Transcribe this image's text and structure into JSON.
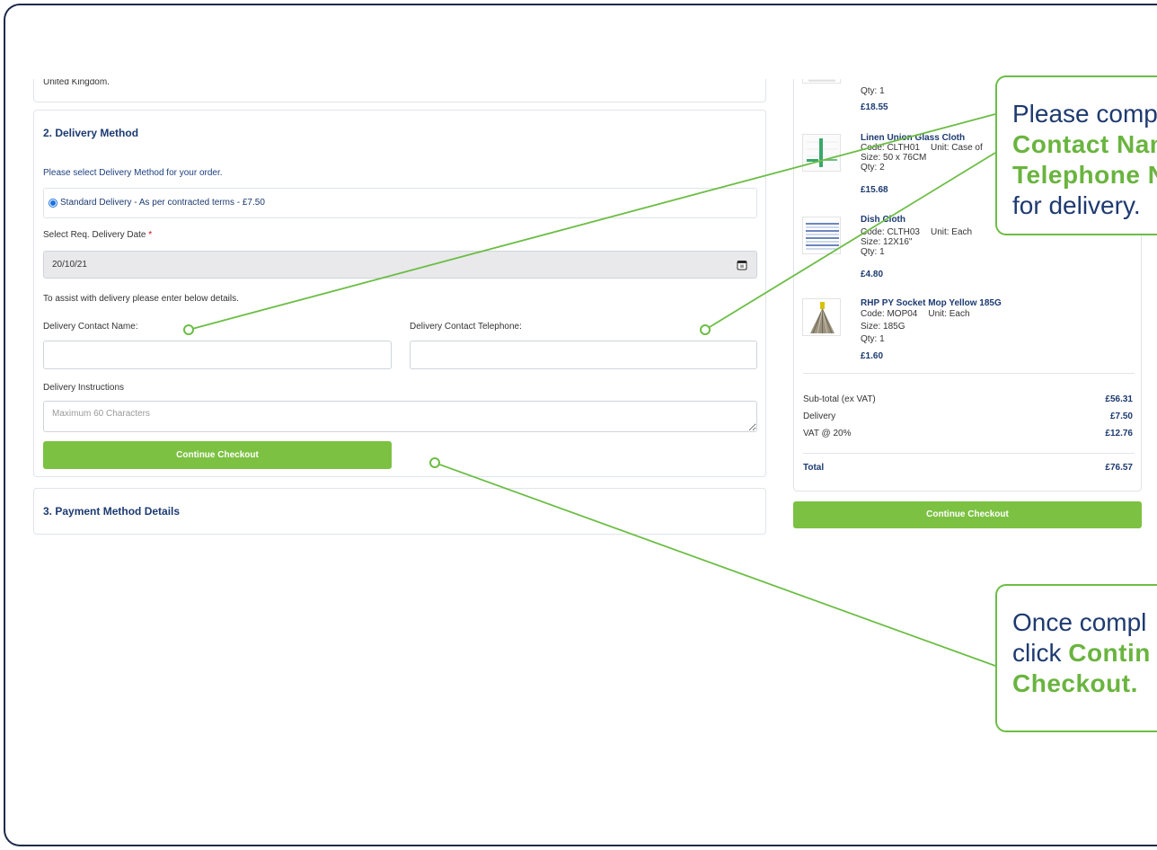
{
  "colors": {
    "frame": "#1c2a4b",
    "navy": "#1c3a70",
    "accent_green": "#7cc142",
    "callout_green": "#6cbd45",
    "radio_blue": "#1a6fe0"
  },
  "address_card": {
    "country_line": "United Kingdom."
  },
  "delivery_method": {
    "title": "2. Delivery Method",
    "instruction": "Please select Delivery Method for your order.",
    "options": [
      {
        "label": "Standard Delivery - As per contracted terms - £7.50",
        "selected": true
      }
    ],
    "date_label": "Select Req. Delivery Date",
    "required_marker": "*",
    "date_value": "20/10/21",
    "date_icon": "calendar-icon",
    "assist_text": "To assist with delivery please enter below details.",
    "contact_name_label": "Delivery Contact Name:",
    "contact_name_value": "",
    "contact_phone_label": "Delivery Contact Telephone:",
    "contact_phone_value": "",
    "instructions_label": "Delivery Instructions",
    "instructions_placeholder": "Maximum 60 Characters",
    "continue_label": "Continue Checkout"
  },
  "payment": {
    "title": "3. Payment Method Details"
  },
  "order_summary": {
    "items": [
      {
        "qty": "Qty: 1",
        "price": "£18.55",
        "image": "product-image"
      },
      {
        "name": "Linen Union Glass Cloth",
        "code": "Code: CLTH01",
        "unit": "Unit: Case of",
        "size": "Size: 50 x 76CM",
        "qty": "Qty: 2",
        "price": "£15.68",
        "image": "glass-cloth-image"
      },
      {
        "name": "Dish Cloth",
        "code": "Code: CLTH03",
        "unit": "Unit: Each",
        "size": "Size: 12X16\"",
        "qty": "Qty: 1",
        "price": "£4.80",
        "image": "dish-cloth-image"
      },
      {
        "name": "RHP PY Socket Mop Yellow 185G",
        "code": "Code: MOP04",
        "unit": "Unit: Each",
        "size": "Size: 185G",
        "qty": "Qty: 1",
        "price": "£1.60",
        "image": "mop-image"
      }
    ],
    "subtotal_label": "Sub-total (ex VAT)",
    "subtotal": "£56.31",
    "delivery_label": "Delivery",
    "delivery": "£7.50",
    "vat_label": "VAT @ 20%",
    "vat": "£12.76",
    "total_label": "Total",
    "total": "£76.57",
    "continue_label": "Continue Checkout"
  },
  "callouts": {
    "contact": {
      "line1": "Please comp",
      "line2": "Contact Nam",
      "line3": "Telephone N",
      "line4": "for delivery."
    },
    "continue": {
      "line1": "Once compl",
      "line2_prefix": "click ",
      "line2_highlight": "Contin",
      "line3": "Checkout."
    }
  }
}
